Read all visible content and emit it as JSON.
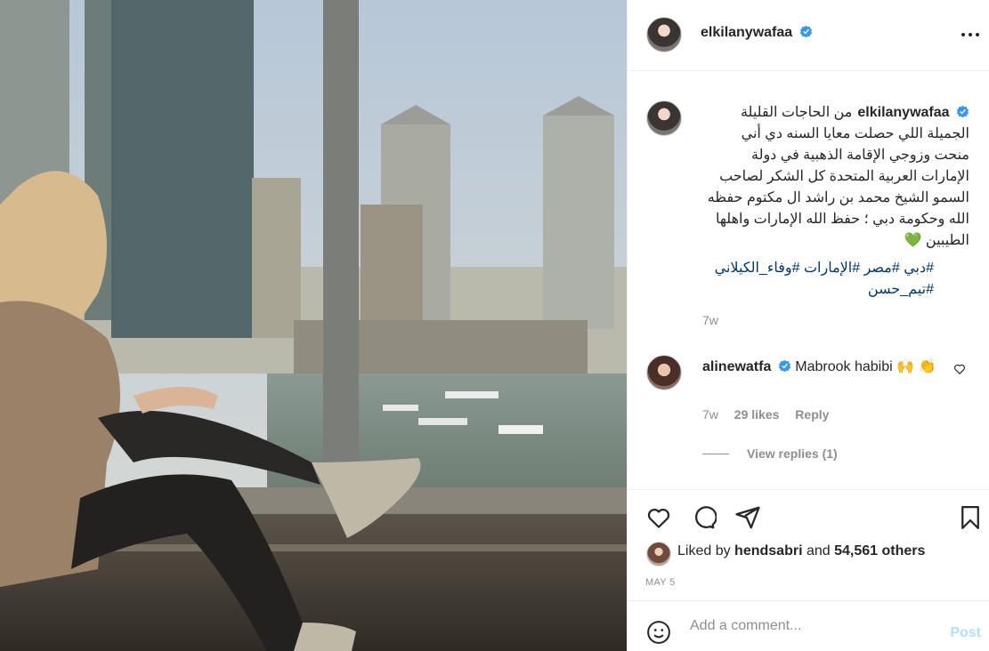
{
  "post": {
    "author": "elkilanywafaa",
    "caption": "من الحاجات القليلة الجميلة اللي حصلت معايا السنه دي أني منحت وزوجي الإقامة الذهبية في دولة الإمارات العربية المتحدة كل الشكر لصاحب السمو الشيخ محمد بن راشد ال مكتوم حفظه الله وحكومة دبي ؛ حفظ الله الإمارات واهلها الطيبين 💚",
    "hashtags": "#دبي #مصر #الإمارات #وفاء_الكيلاني #تيم_حسن",
    "time": "7w"
  },
  "comment": {
    "author": "alinewatfa",
    "text": "Mabrook habibi 🙌 👏",
    "time": "7w",
    "likes": "29 likes",
    "reply": "Reply",
    "view_replies": "View replies (1)"
  },
  "likes": {
    "prefix": "Liked by",
    "user": "hendsabri",
    "middle": "and",
    "others": "54,561 others"
  },
  "date": "MAY 5",
  "add_comment": {
    "placeholder": "Add a comment...",
    "post": "Post"
  },
  "icons": [
    "more-icon",
    "heart-icon",
    "comment-icon",
    "share-icon",
    "save-icon",
    "emoji-icon",
    "verified-icon"
  ],
  "colors": {
    "link": "#00376b",
    "muted": "#8e8e8e",
    "post_disabled": "#b2dffc",
    "verified": "#3897f0",
    "heart_emoji": "#2fbf2f"
  }
}
